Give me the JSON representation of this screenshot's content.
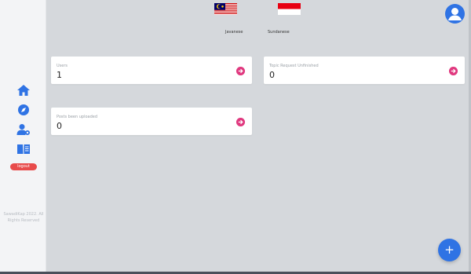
{
  "sidebar": {
    "items": [
      {
        "icon": "home-icon",
        "label": "Home"
      },
      {
        "icon": "compass-icon",
        "label": "Explore"
      },
      {
        "icon": "user-settings-icon",
        "label": "User settings"
      },
      {
        "icon": "book-icon",
        "label": "Library"
      }
    ],
    "logout_label": "logout",
    "copyright_line1": "SawadiKap 2022. All",
    "copyright_line2": "Rights Reserved"
  },
  "header": {
    "languages": [
      {
        "label": "Javanese",
        "flag": "malaysia-flag-icon"
      },
      {
        "label": "Sundanese",
        "flag": "indonesia-flag-icon"
      }
    ],
    "avatar": "user-avatar-icon"
  },
  "cards": [
    {
      "label": "Users",
      "value": "1"
    },
    {
      "label": "Topic Request Unfinished",
      "value": "0"
    },
    {
      "label": "Posts been uploaded",
      "value": "0"
    }
  ],
  "fab_label": "+",
  "colors": {
    "accent_blue": "#2f73e4",
    "accent_pink": "#e0397f",
    "logout_red": "#e84b4b",
    "background": "#d5d8dc"
  }
}
